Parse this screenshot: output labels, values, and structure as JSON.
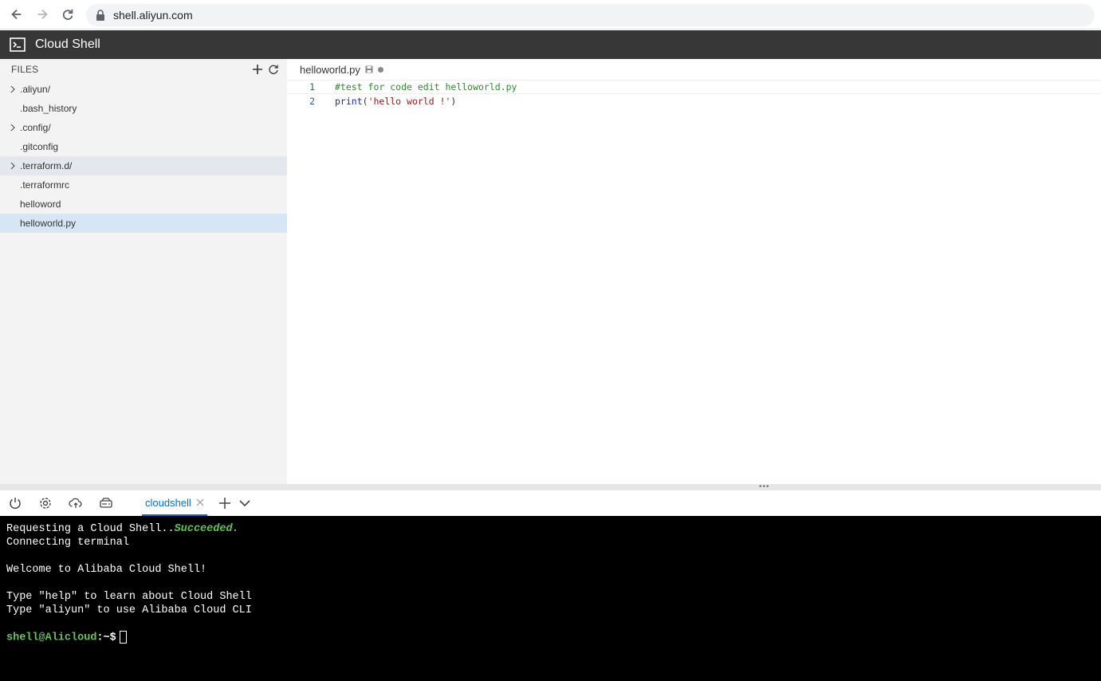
{
  "browser": {
    "url": "shell.aliyun.com"
  },
  "app": {
    "title": "Cloud Shell"
  },
  "sidebar": {
    "heading": "FILES",
    "items": [
      {
        "label": ".aliyun/",
        "type": "folder"
      },
      {
        "label": ".bash_history",
        "type": "file"
      },
      {
        "label": ".config/",
        "type": "folder"
      },
      {
        "label": ".gitconfig",
        "type": "file"
      },
      {
        "label": ".terraform.d/",
        "type": "folder"
      },
      {
        "label": ".terraformrc",
        "type": "file"
      },
      {
        "label": "helloword",
        "type": "file"
      },
      {
        "label": "helloworld.py",
        "type": "file"
      }
    ]
  },
  "editor": {
    "tab_label": "helloworld.py",
    "lines": [
      {
        "number": "1",
        "text": "#test for code edit helloworld.py"
      },
      {
        "number": "2",
        "fn": "print",
        "open": "(",
        "str": "'hello world !'",
        "close": ")"
      }
    ]
  },
  "terminal_toolbar": {
    "tab_label": "cloudshell"
  },
  "terminal": {
    "line1_prefix": "Requesting a Cloud Shell..",
    "line1_status": "Succeeded.",
    "line2": "Connecting terminal",
    "line3": "Welcome to Alibaba Cloud Shell!",
    "line4": "Type \"help\" to learn about Cloud Shell",
    "line5": "Type \"aliyun\" to use Alibaba Cloud CLI",
    "prompt_user": "shell@Alicloud",
    "prompt_rest": ":~$"
  },
  "colors": {
    "accent": "#0070cc",
    "terminal_green": "#62c554",
    "header_bg": "#373737"
  }
}
